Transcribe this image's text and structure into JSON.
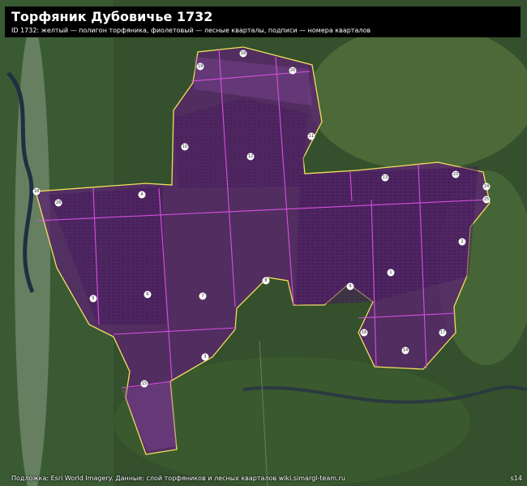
{
  "header": {
    "title": "Торфяник Дубовичье 1732",
    "subtitle": "ID 1732: желтый — полигон торфяника, фиолетовый — лесные кварталы, подписи — номера кварталов"
  },
  "footer": {
    "attribution": "Подложка: Esri World Imagery. Данные: слой торфяников и лесных кварталов wiki.simargl-team.ru",
    "corner_tag": "s14"
  },
  "legend_colors": {
    "peat_polygon": "#f2e05a",
    "forest_quarters": "#d94fe0",
    "fill": "#6a2a80"
  },
  "quarter_labels": [
    "18",
    "19",
    "20",
    "10",
    "12",
    "11",
    "13",
    "18",
    "28",
    "4",
    "5",
    "6",
    "7",
    "8",
    "9",
    "1",
    "2",
    "3",
    "16",
    "17",
    "14",
    "15",
    "23",
    "24",
    "25"
  ]
}
